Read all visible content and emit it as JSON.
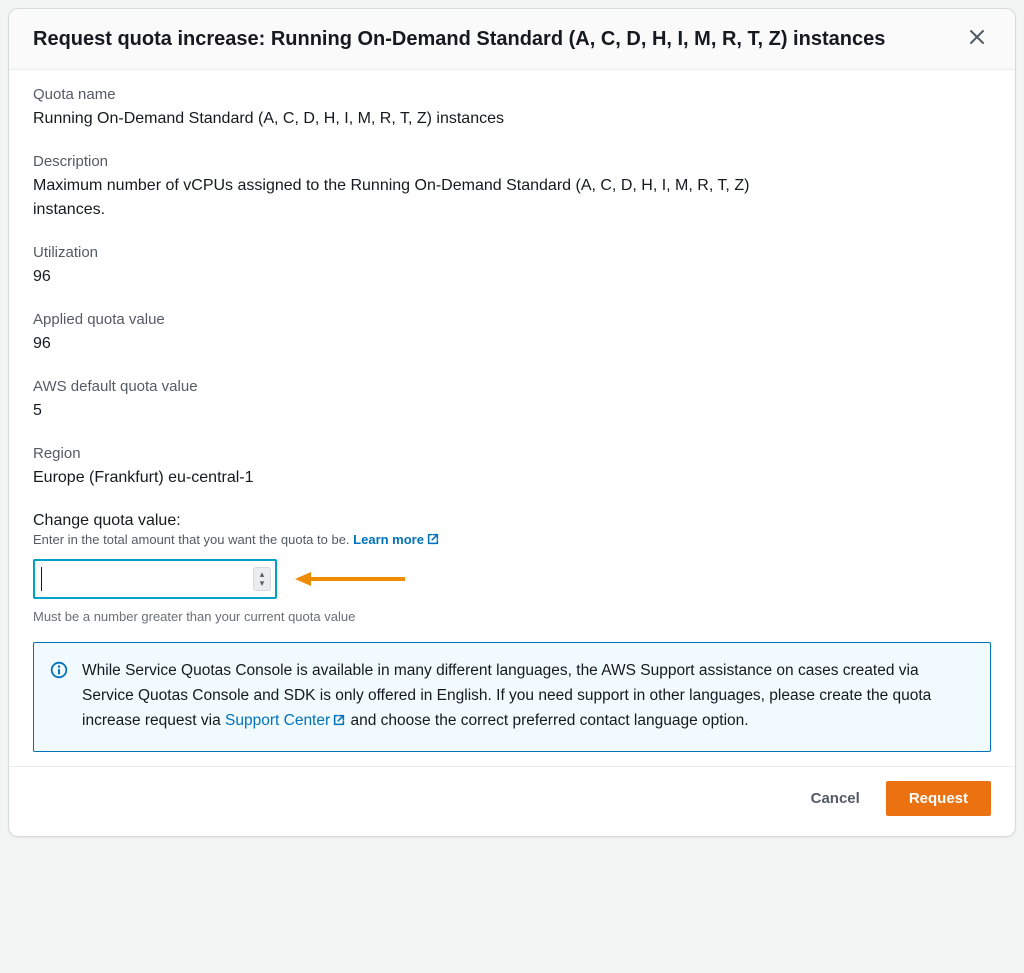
{
  "header": {
    "title": "Request quota increase: Running On-Demand Standard (A, C, D, H, I, M, R, T, Z) instances"
  },
  "fields": {
    "quota_name_label": "Quota name",
    "quota_name_value": "Running On-Demand Standard (A, C, D, H, I, M, R, T, Z) instances",
    "description_label": "Description",
    "description_value": "Maximum number of vCPUs assigned to the Running On-Demand Standard (A, C, D, H, I, M, R, T, Z) instances.",
    "utilization_label": "Utilization",
    "utilization_value": "96",
    "applied_label": "Applied quota value",
    "applied_value": "96",
    "default_label": "AWS default quota value",
    "default_value": "5",
    "region_label": "Region",
    "region_value": "Europe (Frankfurt) eu-central-1"
  },
  "change": {
    "label": "Change quota value:",
    "hint_prefix": "Enter in the total amount that you want the quota to be. ",
    "learn_more": "Learn more",
    "input_value": "",
    "constraint": "Must be a number greater than your current quota value"
  },
  "info": {
    "text_before": "While Service Quotas Console is available in many different languages, the AWS Support assistance on cases created via Service Quotas Console and SDK is only offered in English. If you need support in other languages, please create the quota increase request via ",
    "link": "Support Center",
    "text_after": " and choose the correct preferred contact language option."
  },
  "footer": {
    "cancel": "Cancel",
    "request": "Request"
  }
}
